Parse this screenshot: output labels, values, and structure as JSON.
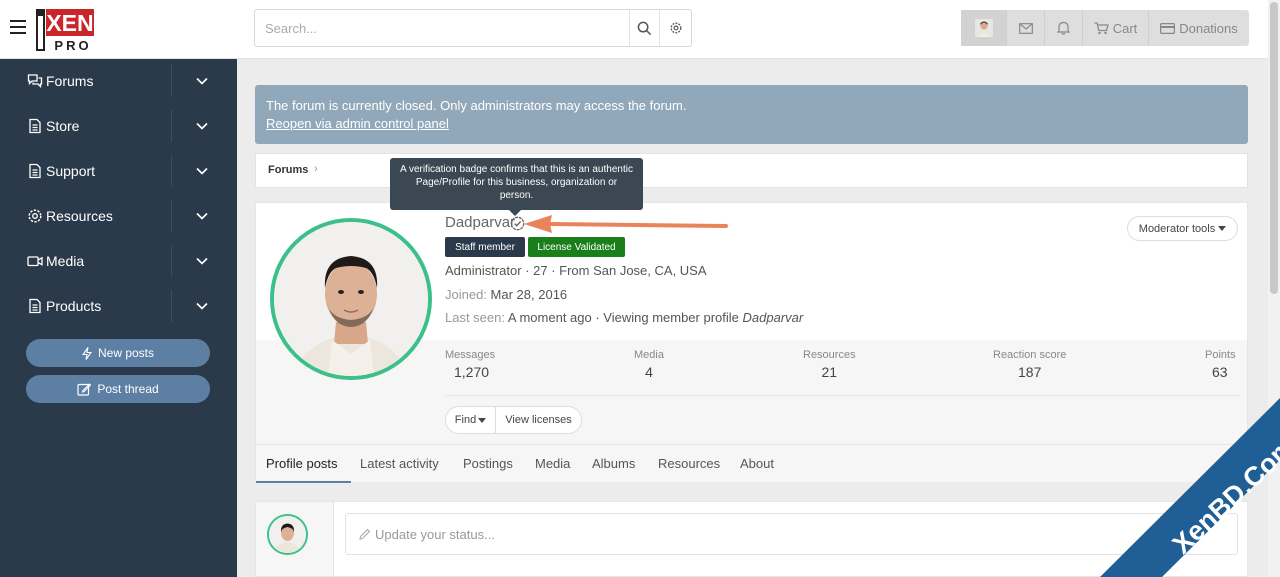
{
  "header": {
    "logo_text_top": "XEN",
    "logo_text_bottom": "PRO",
    "search_placeholder": "Search...",
    "cart_label": "Cart",
    "donations_label": "Donations"
  },
  "sidebar": {
    "items": [
      {
        "label": "Forums",
        "icon": "comments-icon"
      },
      {
        "label": "Store",
        "icon": "document-icon"
      },
      {
        "label": "Support",
        "icon": "document-icon"
      },
      {
        "label": "Resources",
        "icon": "gear-icon"
      },
      {
        "label": "Media",
        "icon": "video-icon"
      },
      {
        "label": "Products",
        "icon": "document-icon"
      }
    ],
    "new_posts": "New posts",
    "post_thread": "Post thread"
  },
  "notice": {
    "text": "The forum is currently closed. Only administrators may access the forum.",
    "link": "Reopen via admin control panel"
  },
  "breadcrumb": {
    "item": "Forums",
    "separator": "›"
  },
  "tooltip": {
    "text": "A verification badge confirms that this is an authentic Page/Profile for this business, organization or person."
  },
  "profile": {
    "username": "Dadparvar",
    "badges": [
      "Staff member",
      "License Validated"
    ],
    "moderator_tools": "Moderator tools",
    "info": "Administrator · 27 · From San Jose, CA, USA",
    "joined_label": "Joined:",
    "joined_value": "Mar 28, 2016",
    "last_seen_label": "Last seen:",
    "last_seen_value": "A moment ago · Viewing member profile",
    "last_seen_page": "Dadparvar",
    "stats": [
      {
        "label": "Messages",
        "value": "1,270"
      },
      {
        "label": "Media",
        "value": "4"
      },
      {
        "label": "Resources",
        "value": "21"
      },
      {
        "label": "Reaction score",
        "value": "187"
      },
      {
        "label": "Points",
        "value": "63"
      }
    ],
    "find_label": "Find",
    "view_licenses": "View licenses"
  },
  "tabs": [
    "Profile posts",
    "Latest activity",
    "Postings",
    "Media",
    "Albums",
    "Resources",
    "About"
  ],
  "status": {
    "placeholder": "Update your status..."
  },
  "watermark": "XenBD.Com",
  "colors": {
    "sidebar_bg": "#2b3a4a",
    "accent": "#5d7fa3",
    "notice_bg": "#91a8ba",
    "avatar_ring": "#3cc08a",
    "license_badge": "#1a7f1a",
    "arrow": "#e8835a",
    "watermark_bg": "#1f5f95"
  }
}
